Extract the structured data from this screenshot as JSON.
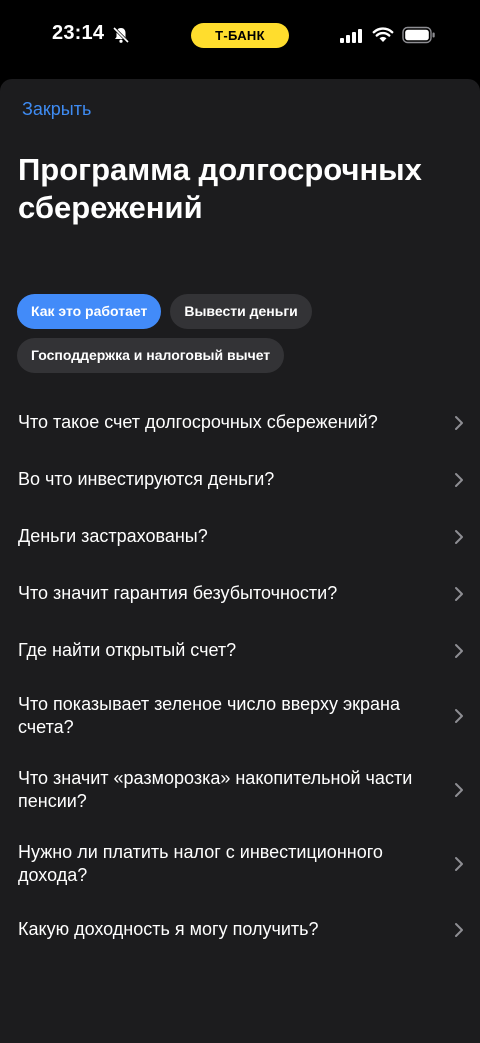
{
  "status_bar": {
    "time": "23:14",
    "bank_label": "Т-БАНК"
  },
  "sheet": {
    "close_label": "Закрыть",
    "title": "Программа долгосрочных сбережений",
    "chips": [
      {
        "label": "Как это работает",
        "active": true
      },
      {
        "label": "Вывести деньги",
        "active": false
      },
      {
        "label": "Господдержка и налоговый вычет",
        "active": false
      }
    ],
    "faq": [
      "Что такое счет долгосрочных сбережений?",
      "Во что инвестируются деньги?",
      "Деньги застрахованы?",
      "Что значит гарантия безубыточности?",
      "Где найти открытый счет?",
      "Что показывает зеленое число вверху экрана счета?",
      "Что значит «разморозка» накопительной части пенсии?",
      "Нужно ли платить налог с инвестиционного дохода?",
      "Какую доходность я могу получить?"
    ]
  },
  "colors": {
    "accent": "#428bf9",
    "link": "#3e8bf2",
    "brand_yellow": "#FFDD2D",
    "sheet_bg": "#1c1c1e",
    "chip_bg": "#333336"
  },
  "icons": [
    "bell-off-icon",
    "signal-icon",
    "wifi-icon",
    "battery-icon",
    "chevron-right-icon"
  ]
}
